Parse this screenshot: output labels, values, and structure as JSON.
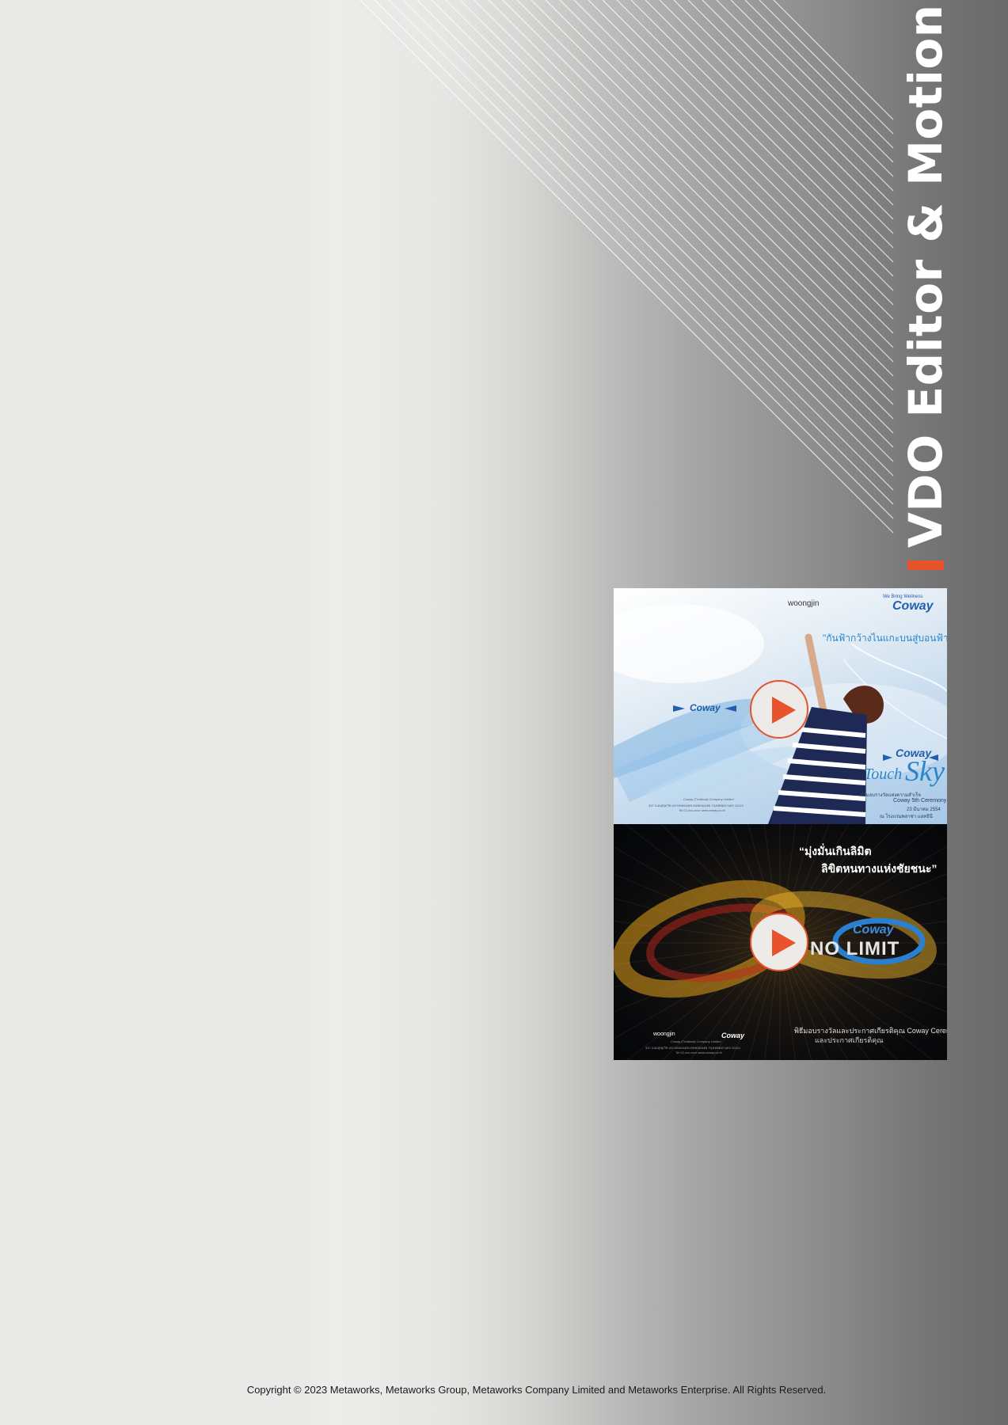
{
  "section": {
    "title": "VDO Editor & Motion",
    "accent_color": "#e8522c"
  },
  "videos": [
    {
      "id": "touch-sky",
      "brand_tagline": "We Bring Wellness",
      "brand": "Coway",
      "partner_logo": "woongjin",
      "headline": "\"กันฟ้ากว้างไนแกะบนสู่บอนฟ้า\"",
      "wing_logo": "Coway",
      "title_brand": "Coway",
      "title_script_1": "Touch",
      "title_script_2": "Sky",
      "event_details": [
        "พิธีมอบรางวัลแห่งความสำเร็จ",
        "Coway 5th Ceremony",
        "23 มีนาคม 2554",
        "ณ โรงแรมพลาซ่า แอทธินี"
      ],
      "fine_print": [
        "Coway (Thailand) Company Limited",
        "337 ถนนสุขุมวิท แขวงคลองเตย เขตคลองเตย กรุงเทพมหานคร 10110",
        "Tel 02-xxx-xxxx  www.coway.co.th"
      ],
      "play_icon": "play-icon"
    },
    {
      "id": "no-limit",
      "headline_line1": "“มุ่งมั่นเกินลิมิต",
      "headline_line2": "ลิขิตหนทางแห่งชัยชนะ”",
      "brand": "Coway",
      "logo_text": "NO LIMIT",
      "event_line1": "พิธีมอบรางวัลและประกาศเกียรติคุณ Coway Ceremony",
      "event_line2": "และประกาศเกียรติคุณ",
      "fine_print": [
        "Coway (Thailand) Company Limited",
        "337 ถนนสุขุมวิท แขวงคลองเตย เขตคลองเตย กรุงเทพมหานคร 10110",
        "Tel 02-xxx-xxxx  www.coway.co.th"
      ],
      "play_icon": "play-icon"
    }
  ],
  "footer": {
    "copyright": "Copyright © 2023 Metaworks, Metaworks Group, Metaworks Company Limited and Metaworks Enterprise. All Rights Reserved."
  }
}
